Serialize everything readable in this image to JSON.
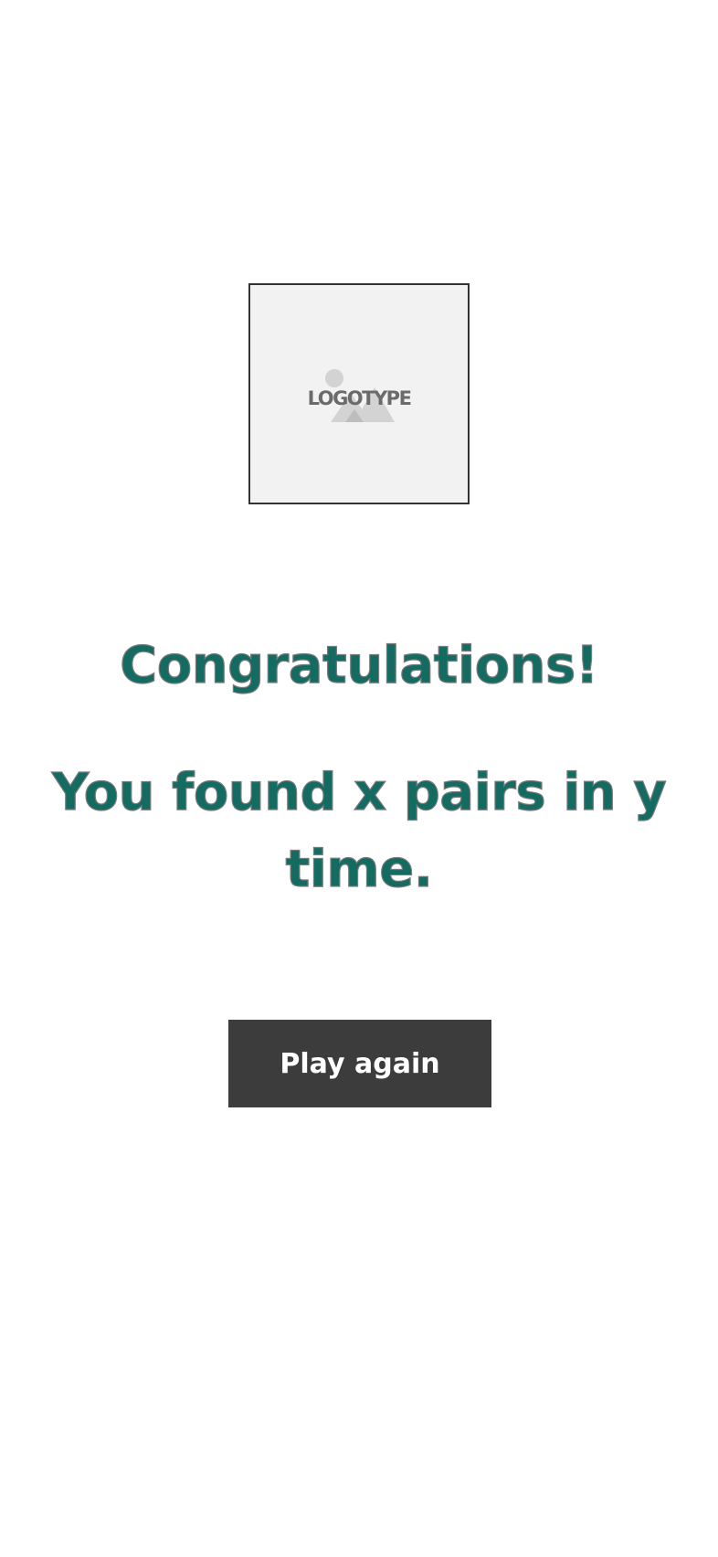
{
  "logo": {
    "text": "LOGOTYPE"
  },
  "message": {
    "title": "Congratulations!",
    "result": "You found x pairs in y time."
  },
  "actions": {
    "play_again_label": "Play again"
  },
  "colors": {
    "headline": "#146b61",
    "button_bg": "#3c3c3c",
    "button_text": "#ffffff"
  }
}
